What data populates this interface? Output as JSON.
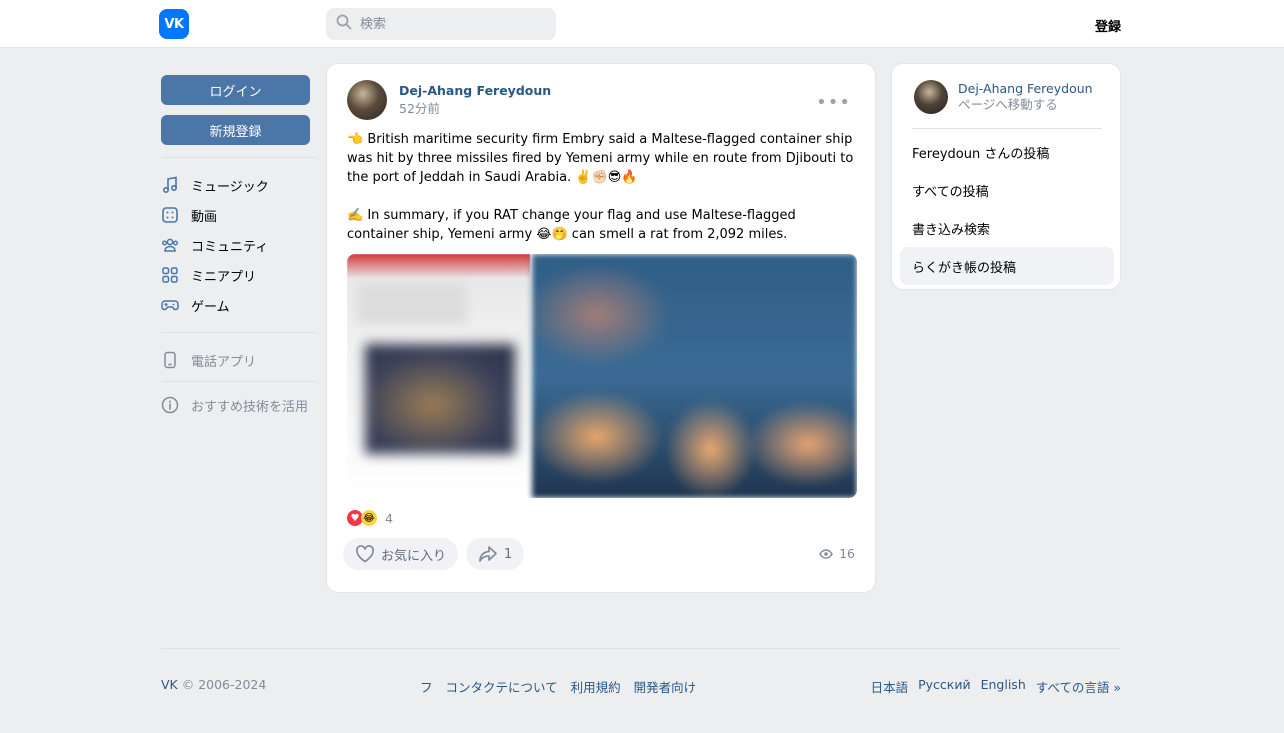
{
  "header": {
    "logo_text": "VK",
    "search_placeholder": "検索",
    "signup_label": "登録"
  },
  "left_menu": {
    "login_label": "ログイン",
    "register_label": "新規登録",
    "items": [
      {
        "label": "ミュージック",
        "icon": "music-icon"
      },
      {
        "label": "動画",
        "icon": "video-icon"
      },
      {
        "label": "コミュニティ",
        "icon": "community-icon"
      },
      {
        "label": "ミニアプリ",
        "icon": "mini-apps-icon"
      },
      {
        "label": "ゲーム",
        "icon": "gamepad-icon"
      }
    ],
    "phone_app_label": "電話アプリ",
    "recommend_label": "おすすめ技術を活用"
  },
  "post": {
    "author": "Dej-Ahang Fereydoun",
    "time": "52分前",
    "paragraph1": "👈 British maritime security firm Embry said a Maltese-flagged container ship was hit by three missiles fired by Yemeni army while en route from Djibouti to the port of Jeddah in Saudi Arabia. ✌️✊🏻😎🔥",
    "paragraph2": "✍️ In summary, if you RAT change your flag and use Maltese-flagged container ship, Yemeni army 😂🤭 can smell a rat from 2,092 miles.",
    "reactions_count": "4",
    "like_label": "お気に入り",
    "share_count": "1",
    "views": "16"
  },
  "sidebar": {
    "name": "Dej-Ahang Fereydoun",
    "goto_label": "ページへ移動する",
    "items": [
      {
        "label": "Fereydoun さんの投稿"
      },
      {
        "label": "すべての投稿"
      },
      {
        "label": "書き込み検索"
      },
      {
        "label": "らくがき帳の投稿"
      }
    ]
  },
  "footer": {
    "brand": "VK",
    "copyright": " © 2006-2024",
    "links": [
      "フ",
      "コンタクテについて",
      "利用規約",
      "開発者向け"
    ],
    "languages": [
      "日本語",
      "Русский",
      "English",
      "すべての言語 »"
    ]
  }
}
